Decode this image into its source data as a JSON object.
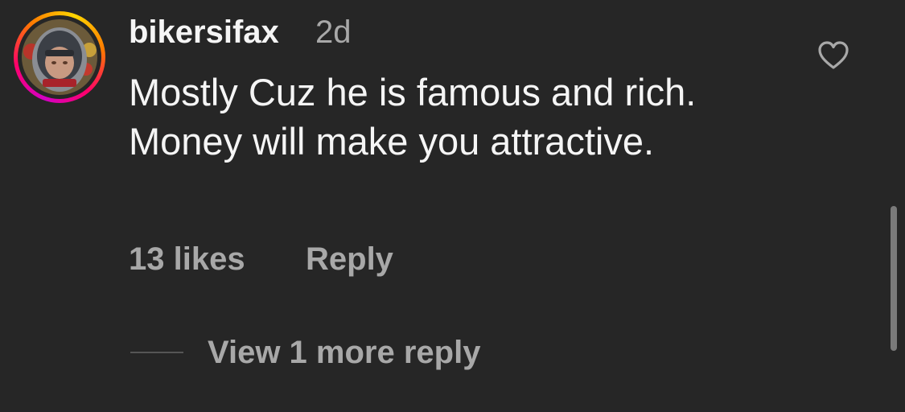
{
  "comment": {
    "username": "bikersifax",
    "timestamp": "2d",
    "text": "Mostly Cuz he is famous and rich.  Money will make you attractive.",
    "likes": "13 likes",
    "reply_label": "Reply",
    "view_replies_label": "View 1 more reply",
    "avatar_icon": "helmet-avatar",
    "like_icon": "heart-outline-icon"
  },
  "colors": {
    "background": "#262626",
    "primary_text": "#f5f5f5",
    "secondary_text": "#a8a8a8",
    "story_ring": [
      "#d300c5",
      "#ff0069",
      "#ff7a00",
      "#ffd600"
    ]
  }
}
